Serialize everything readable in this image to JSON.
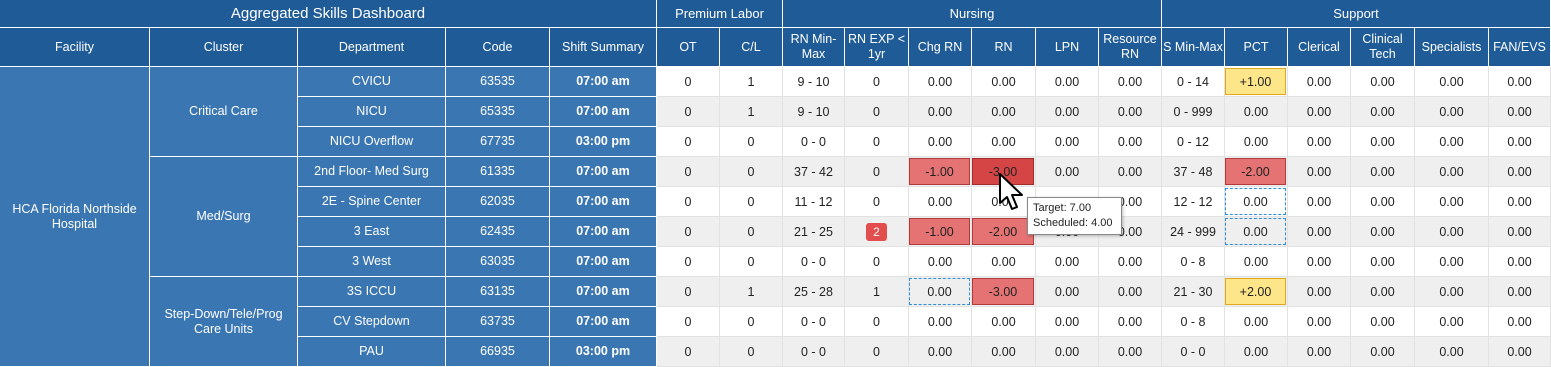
{
  "dashboard_title": "Aggregated Skills Dashboard",
  "groups": {
    "premium": "Premium Labor",
    "nursing": "Nursing",
    "support": "Support"
  },
  "headers": [
    "Facility",
    "Cluster",
    "Department",
    "Code",
    "Shift Summary",
    "OT",
    "C/L",
    "RN Min-Max",
    "RN EXP < 1yr",
    "Chg RN",
    "RN",
    "LPN",
    "Resource RN",
    "S Min-Max",
    "PCT",
    "Clerical",
    "Clinical Tech",
    "Specialists",
    "FAN/EVS"
  ],
  "facility": "HCA Florida Northside Hospital",
  "clusters": [
    "Critical Care",
    "Med/Surg",
    "Step-Down/Tele/Prog Care Units"
  ],
  "rows": [
    {
      "dept": "CVICU",
      "code": "63535",
      "shift": "07:00 am",
      "vals": [
        "0",
        "1",
        "9 - 10",
        "0",
        "0.00",
        "0.00",
        "0.00",
        "0.00",
        "0 - 14",
        "+1.00",
        "0.00",
        "0.00",
        "0.00",
        "0.00"
      ]
    },
    {
      "dept": "NICU",
      "code": "65335",
      "shift": "07:00 am",
      "vals": [
        "0",
        "1",
        "9 - 10",
        "0",
        "0.00",
        "0.00",
        "0.00",
        "0.00",
        "0 - 999",
        "0.00",
        "0.00",
        "0.00",
        "0.00",
        "0.00"
      ]
    },
    {
      "dept": "NICU Overflow",
      "code": "67735",
      "shift": "03:00 pm",
      "vals": [
        "0",
        "0",
        "0 - 0",
        "0",
        "0.00",
        "0.00",
        "0.00",
        "0.00",
        "0 - 12",
        "0.00",
        "0.00",
        "0.00",
        "0.00",
        "0.00"
      ]
    },
    {
      "dept": "2nd Floor- Med Surg",
      "code": "61335",
      "shift": "07:00 am",
      "vals": [
        "0",
        "0",
        "37 - 42",
        "0",
        "-1.00",
        "-3.00",
        "0.00",
        "0.00",
        "37 - 48",
        "-2.00",
        "0.00",
        "0.00",
        "0.00",
        "0.00"
      ]
    },
    {
      "dept": "2E - Spine Center",
      "code": "62035",
      "shift": "07:00 am",
      "vals": [
        "0",
        "0",
        "11 - 12",
        "0",
        "0.00",
        "0.00",
        "0.00",
        "0.00",
        "12 - 12",
        "0.00",
        "0.00",
        "0.00",
        "0.00",
        "0.00"
      ]
    },
    {
      "dept": "3 East",
      "code": "62435",
      "shift": "07:00 am",
      "vals": [
        "0",
        "0",
        "21 - 25",
        "2",
        "-1.00",
        "-2.00",
        "0.00",
        "0.00",
        "24 - 999",
        "0.00",
        "0.00",
        "0.00",
        "0.00",
        "0.00"
      ]
    },
    {
      "dept": "3 West",
      "code": "63035",
      "shift": "07:00 am",
      "vals": [
        "0",
        "0",
        "0 - 0",
        "0",
        "0.00",
        "0.00",
        "0.00",
        "0.00",
        "0 - 8",
        "0.00",
        "0.00",
        "0.00",
        "0.00",
        "0.00"
      ]
    },
    {
      "dept": "3S ICCU",
      "code": "63135",
      "shift": "07:00 am",
      "vals": [
        "0",
        "1",
        "25 - 28",
        "1",
        "0.00",
        "-3.00",
        "0.00",
        "0.00",
        "21 - 30",
        "+2.00",
        "0.00",
        "0.00",
        "0.00",
        "0.00"
      ]
    },
    {
      "dept": "CV Stepdown",
      "code": "63735",
      "shift": "07:00 am",
      "vals": [
        "0",
        "0",
        "0 - 0",
        "0",
        "0.00",
        "0.00",
        "0.00",
        "0.00",
        "0 - 8",
        "0.00",
        "0.00",
        "0.00",
        "0.00",
        "0.00"
      ]
    },
    {
      "dept": "PAU",
      "code": "66935",
      "shift": "03:00 pm",
      "vals": [
        "0",
        "0",
        "0 - 0",
        "0",
        "0.00",
        "0.00",
        "0.00",
        "0.00",
        "0 - 0",
        "0.00",
        "0.00",
        "0.00",
        "0.00",
        "0.00"
      ]
    }
  ],
  "tooltip": {
    "target": "Target: 7.00",
    "scheduled": "Scheduled: 4.00"
  },
  "icons": {
    "cursor": "mouse-pointer-icon"
  },
  "colors": {
    "header_bg": "#1f5b96",
    "label_bg": "#3a76b1",
    "shortage": "#e57373",
    "surplus": "#fde68a",
    "dashed_outline": "#2f8ed8"
  }
}
